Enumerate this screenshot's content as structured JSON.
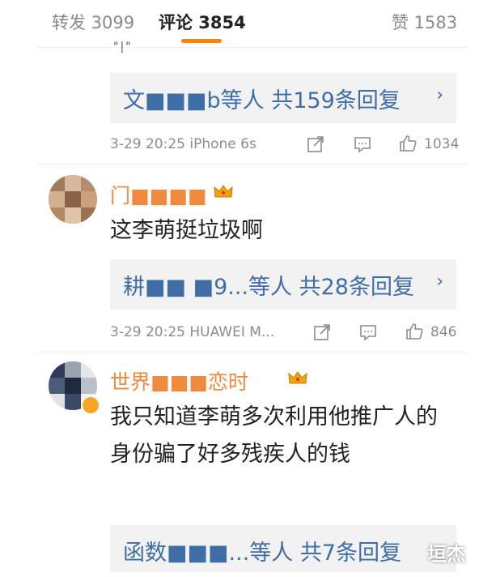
{
  "tabs": [
    {
      "label": "转发 3099"
    },
    {
      "label": "评论 3854"
    },
    {
      "label": "赞 1583"
    }
  ],
  "top_fragment": "\"|\"",
  "threads": [
    {
      "reply_summary": "文■■■b等人 共159条回复",
      "timestamp": "3-29 20:25 iPhone 6s",
      "likes": "1034"
    },
    {
      "username": "门■■■■",
      "comment": "这李萌挺垃圾啊",
      "reply_summary": "耕■■ ■9...等人 共28条回复",
      "timestamp": "3-29 20:25 HUAWEI M...",
      "likes": "846"
    },
    {
      "username": "世界■■■恋时",
      "comment": "我只知道李萌多次利用他推广人的身份骗了好多残疾人的钱",
      "reply_summary": "函数■■■...等人 共7条回复"
    }
  ],
  "icons": {
    "reply_arrow": "chevron-right-icon",
    "repost": "repost-icon",
    "comment": "comment-icon",
    "like": "thumbs-up-icon",
    "crown": "crown-icon"
  },
  "colors": {
    "accent": "#ff8200",
    "link": "#3f6ea6",
    "username": "#f08a3e"
  },
  "watermark": "垣杰"
}
